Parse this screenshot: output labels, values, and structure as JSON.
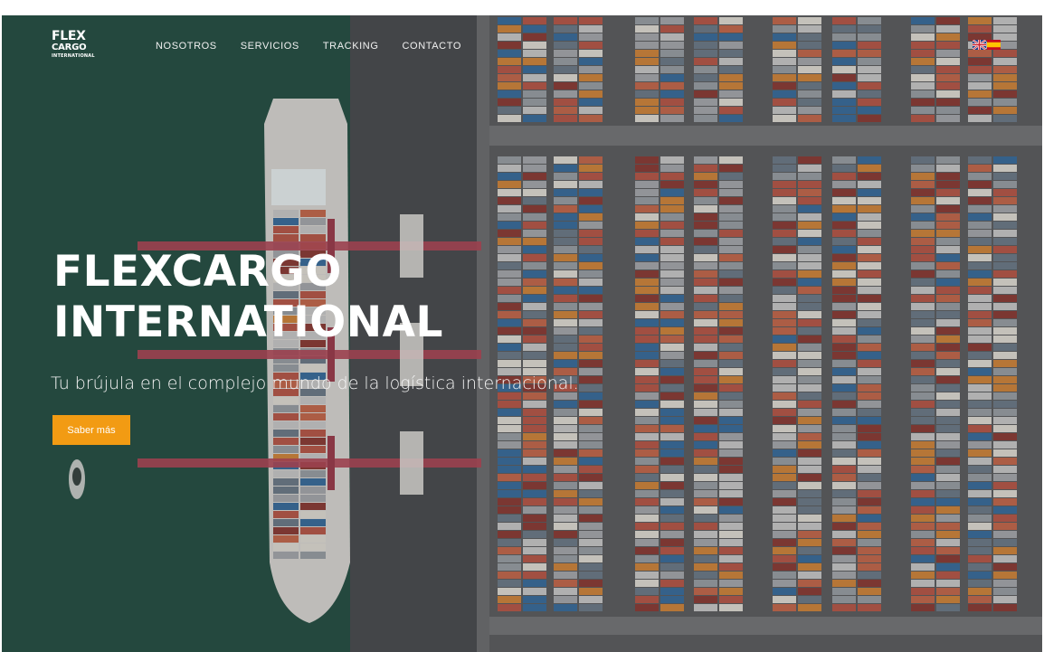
{
  "logo": {
    "line1": "FLEX",
    "line2": "CARGO",
    "line3": "INTERNATIONAL"
  },
  "nav": {
    "items": [
      {
        "label": "NOSOTROS"
      },
      {
        "label": "SERVICIOS"
      },
      {
        "label": "TRACKING"
      },
      {
        "label": "CONTACTO"
      }
    ],
    "languages": [
      "English",
      "Español"
    ]
  },
  "hero": {
    "title_line1": "FLEXCARGO",
    "title_line2": "INTERNATIONAL",
    "subtitle": "Tu brújula en el complejo mundo de la logística internacional.",
    "cta_label": "Saber más"
  },
  "colors": {
    "sea": "#2f5c4f",
    "accent": "#f29b13",
    "crane": "#b14a5a"
  }
}
